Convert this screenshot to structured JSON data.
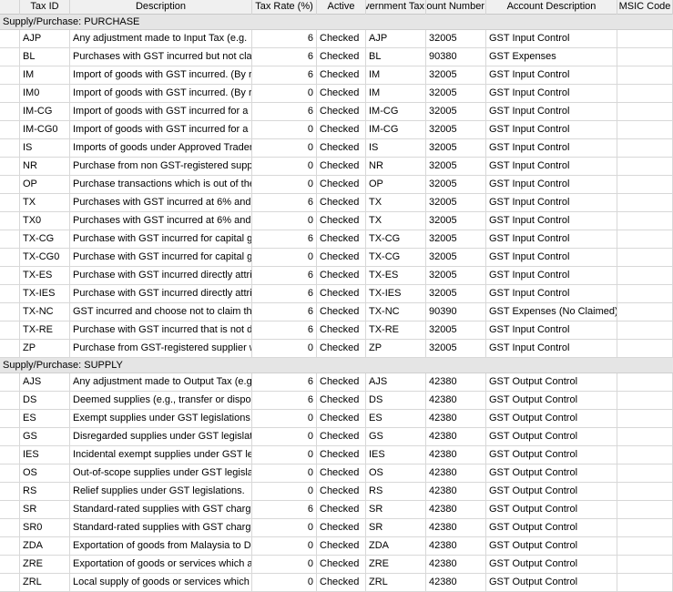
{
  "columns": {
    "tax_id": "Tax ID",
    "description": "Description",
    "tax_rate": "Tax Rate (%)",
    "active": "Active",
    "gov_tax": "Government Tax",
    "account_number": "Account Number",
    "account_description": "Account Description",
    "msic_code": "MSIC Code"
  },
  "groups": [
    {
      "label": "Supply/Purchase: PURCHASE",
      "rows": [
        {
          "tax_id": "AJP",
          "description": "Any adjustment made to Input Tax (e.g.",
          "tax_rate": "6",
          "active": "Checked",
          "gov_tax": "AJP",
          "account_number": "32005",
          "account_description": "GST Input Control",
          "msic_code": ""
        },
        {
          "tax_id": "BL",
          "description": "Purchases with GST incurred but not clain",
          "tax_rate": "6",
          "active": "Checked",
          "gov_tax": "BL",
          "account_number": "90380",
          "account_description": "GST Expenses",
          "msic_code": ""
        },
        {
          "tax_id": "IM",
          "description": "Import of goods with GST incurred. (By re",
          "tax_rate": "6",
          "active": "Checked",
          "gov_tax": "IM",
          "account_number": "32005",
          "account_description": "GST Input Control",
          "msic_code": ""
        },
        {
          "tax_id": "IM0",
          "description": "Import of goods with GST incurred. (By re",
          "tax_rate": "0",
          "active": "Checked",
          "gov_tax": "IM",
          "account_number": "32005",
          "account_description": "GST Input Control",
          "msic_code": ""
        },
        {
          "tax_id": "IM-CG",
          "description": "Import of goods with GST incurred for a c",
          "tax_rate": "6",
          "active": "Checked",
          "gov_tax": "IM-CG",
          "account_number": "32005",
          "account_description": "GST Input Control",
          "msic_code": ""
        },
        {
          "tax_id": "IM-CG0",
          "description": "Import of goods with GST incurred for a c",
          "tax_rate": "0",
          "active": "Checked",
          "gov_tax": "IM-CG",
          "account_number": "32005",
          "account_description": "GST Input Control",
          "msic_code": ""
        },
        {
          "tax_id": "IS",
          "description": "Imports of goods under Approved Trader",
          "tax_rate": "0",
          "active": "Checked",
          "gov_tax": "IS",
          "account_number": "32005",
          "account_description": "GST Input Control",
          "msic_code": ""
        },
        {
          "tax_id": "NR",
          "description": "Purchase from non GST-registered suppli",
          "tax_rate": "0",
          "active": "Checked",
          "gov_tax": "NR",
          "account_number": "32005",
          "account_description": "GST Input Control",
          "msic_code": ""
        },
        {
          "tax_id": "OP",
          "description": "Purchase transactions which is out of the",
          "tax_rate": "0",
          "active": "Checked",
          "gov_tax": "OP",
          "account_number": "32005",
          "account_description": "GST Input Control",
          "msic_code": ""
        },
        {
          "tax_id": "TX",
          "description": "Purchases with GST incurred at 6% and c",
          "tax_rate": "6",
          "active": "Checked",
          "gov_tax": "TX",
          "account_number": "32005",
          "account_description": "GST Input Control",
          "msic_code": ""
        },
        {
          "tax_id": "TX0",
          "description": "Purchases with GST incurred at 6% and c",
          "tax_rate": "0",
          "active": "Checked",
          "gov_tax": "TX",
          "account_number": "32005",
          "account_description": "GST Input Control",
          "msic_code": ""
        },
        {
          "tax_id": "TX-CG",
          "description": "Purchase with GST incurred for capital go",
          "tax_rate": "6",
          "active": "Checked",
          "gov_tax": "TX-CG",
          "account_number": "32005",
          "account_description": "GST Input Control",
          "msic_code": ""
        },
        {
          "tax_id": "TX-CG0",
          "description": "Purchase with GST incurred for capital go",
          "tax_rate": "0",
          "active": "Checked",
          "gov_tax": "TX-CG",
          "account_number": "32005",
          "account_description": "GST Input Control",
          "msic_code": ""
        },
        {
          "tax_id": "TX-ES",
          "description": "Purchase with GST incurred directly attrib",
          "tax_rate": "6",
          "active": "Checked",
          "gov_tax": "TX-ES",
          "account_number": "32005",
          "account_description": "GST Input Control",
          "msic_code": ""
        },
        {
          "tax_id": "TX-IES",
          "description": "Purchase with GST incurred directly attrib",
          "tax_rate": "6",
          "active": "Checked",
          "gov_tax": "TX-IES",
          "account_number": "32005",
          "account_description": "GST Input Control",
          "msic_code": ""
        },
        {
          "tax_id": "TX-NC",
          "description": "GST incurred and choose not to claim the",
          "tax_rate": "6",
          "active": "Checked",
          "gov_tax": "TX-NC",
          "account_number": "90390",
          "account_description": "GST Expenses (No Claimed)",
          "msic_code": ""
        },
        {
          "tax_id": "TX-RE",
          "description": "Purchase with GST incurred that is not dir",
          "tax_rate": "6",
          "active": "Checked",
          "gov_tax": "TX-RE",
          "account_number": "32005",
          "account_description": "GST Input Control",
          "msic_code": ""
        },
        {
          "tax_id": "ZP",
          "description": "Purchase from GST-registered supplier wi",
          "tax_rate": "0",
          "active": "Checked",
          "gov_tax": "ZP",
          "account_number": "32005",
          "account_description": "GST Input Control",
          "msic_code": ""
        }
      ]
    },
    {
      "label": "Supply/Purchase: SUPPLY",
      "rows": [
        {
          "tax_id": "AJS",
          "description": "Any adjustment made to Output Tax (e.g",
          "tax_rate": "6",
          "active": "Checked",
          "gov_tax": "AJS",
          "account_number": "42380",
          "account_description": "GST Output Control",
          "msic_code": ""
        },
        {
          "tax_id": "DS",
          "description": "Deemed supplies (e.g., transfer or dispos",
          "tax_rate": "6",
          "active": "Checked",
          "gov_tax": "DS",
          "account_number": "42380",
          "account_description": "GST Output Control",
          "msic_code": ""
        },
        {
          "tax_id": "ES",
          "description": "Exempt supplies under GST legislations.",
          "tax_rate": "0",
          "active": "Checked",
          "gov_tax": "ES",
          "account_number": "42380",
          "account_description": "GST Output Control",
          "msic_code": ""
        },
        {
          "tax_id": "GS",
          "description": "Disregarded supplies under GST legislatio",
          "tax_rate": "0",
          "active": "Checked",
          "gov_tax": "GS",
          "account_number": "42380",
          "account_description": "GST Output Control",
          "msic_code": ""
        },
        {
          "tax_id": "IES",
          "description": "Incidental exempt supplies under GST leg",
          "tax_rate": "0",
          "active": "Checked",
          "gov_tax": "IES",
          "account_number": "42380",
          "account_description": "GST Output Control",
          "msic_code": ""
        },
        {
          "tax_id": "OS",
          "description": "Out-of-scope supplies under GST legislati",
          "tax_rate": "0",
          "active": "Checked",
          "gov_tax": "OS",
          "account_number": "42380",
          "account_description": "GST Output Control",
          "msic_code": ""
        },
        {
          "tax_id": "RS",
          "description": "Relief supplies under GST legislations.",
          "tax_rate": "0",
          "active": "Checked",
          "gov_tax": "RS",
          "account_number": "42380",
          "account_description": "GST Output Control",
          "msic_code": ""
        },
        {
          "tax_id": "SR",
          "description": "Standard-rated supplies with GST charge",
          "tax_rate": "6",
          "active": "Checked",
          "gov_tax": "SR",
          "account_number": "42380",
          "account_description": "GST Output Control",
          "msic_code": ""
        },
        {
          "tax_id": "SR0",
          "description": "Standard-rated supplies with GST charge",
          "tax_rate": "0",
          "active": "Checked",
          "gov_tax": "SR",
          "account_number": "42380",
          "account_description": "GST Output Control",
          "msic_code": ""
        },
        {
          "tax_id": "ZDA",
          "description": "Exportation of goods from Malaysia to De",
          "tax_rate": "0",
          "active": "Checked",
          "gov_tax": "ZDA",
          "account_number": "42380",
          "account_description": "GST Output Control",
          "msic_code": ""
        },
        {
          "tax_id": "ZRE",
          "description": "Exportation of goods or services which ar",
          "tax_rate": "0",
          "active": "Checked",
          "gov_tax": "ZRE",
          "account_number": "42380",
          "account_description": "GST Output Control",
          "msic_code": ""
        },
        {
          "tax_id": "ZRL",
          "description": "Local supply of goods or services which a",
          "tax_rate": "0",
          "active": "Checked",
          "gov_tax": "ZRL",
          "account_number": "42380",
          "account_description": "GST Output Control",
          "msic_code": ""
        }
      ]
    }
  ]
}
